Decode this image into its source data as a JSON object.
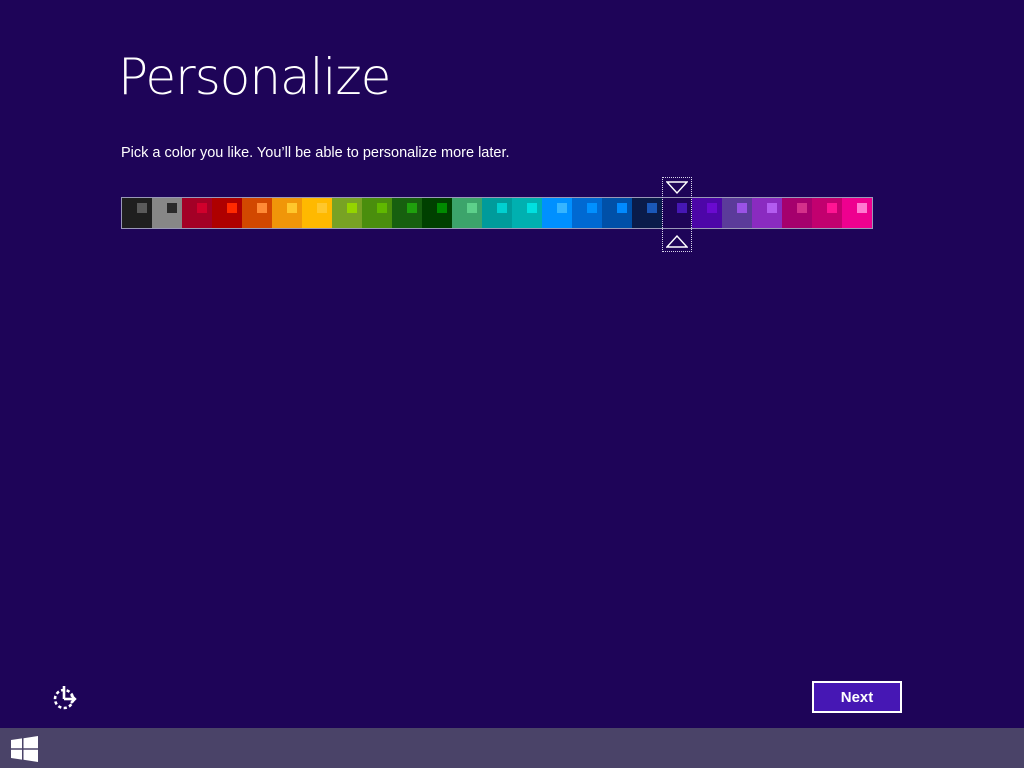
{
  "theme": {
    "background": "#1e0458",
    "taskbar": "#4a4368",
    "accent": "#4617b4"
  },
  "page": {
    "title": "Personalize",
    "instruction": "Pick a color you like. You’ll be able to personalize more later."
  },
  "palette": {
    "selected_index": 18,
    "swatches": [
      {
        "base": "#1f1f1f",
        "chip": "#5a5a5a"
      },
      {
        "base": "#878787",
        "chip": "#2a2a2a"
      },
      {
        "base": "#a30026",
        "chip": "#d0002c"
      },
      {
        "base": "#ae0000",
        "chip": "#ff2a00"
      },
      {
        "base": "#d24800",
        "chip": "#ff8a35"
      },
      {
        "base": "#f09609",
        "chip": "#ffc72c"
      },
      {
        "base": "#ffb900",
        "chip": "#ffc72c"
      },
      {
        "base": "#78a224",
        "chip": "#94d400"
      },
      {
        "base": "#4a8e0d",
        "chip": "#60b800"
      },
      {
        "base": "#17600f",
        "chip": "#1fa10d"
      },
      {
        "base": "#004000",
        "chip": "#008a00"
      },
      {
        "base": "#3ca46b",
        "chip": "#5dd08b"
      },
      {
        "base": "#009b9b",
        "chip": "#00d0d0"
      },
      {
        "base": "#00b0b0",
        "chip": "#00e0e0"
      },
      {
        "base": "#0090ff",
        "chip": "#36b5ff"
      },
      {
        "base": "#0069d2",
        "chip": "#0090ff"
      },
      {
        "base": "#0050a8",
        "chip": "#008aff"
      },
      {
        "base": "#0a1c4a",
        "chip": "#1a58b8"
      },
      {
        "base": "#1e0458",
        "chip": "#4617b4"
      },
      {
        "base": "#4d06a8",
        "chip": "#6a0ad0"
      },
      {
        "base": "#5b3b9a",
        "chip": "#9a52e6"
      },
      {
        "base": "#8a2bc0",
        "chip": "#b35cf0"
      },
      {
        "base": "#a5006d",
        "chip": "#d4308a"
      },
      {
        "base": "#c2006f",
        "chip": "#ff1493"
      },
      {
        "base": "#ee008f",
        "chip": "#ff7ad0"
      }
    ]
  },
  "buttons": {
    "next": "Next"
  },
  "icons": {
    "ease_of_access": "ease-of-access-icon",
    "windows_logo": "windows-logo-icon",
    "selector_down": "triangle-down-icon",
    "selector_up": "triangle-up-icon"
  }
}
